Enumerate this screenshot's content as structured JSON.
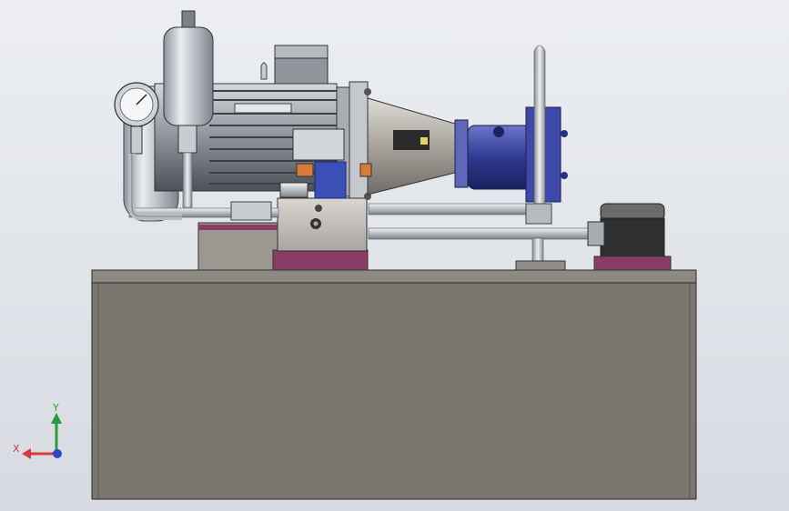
{
  "scene": {
    "background_top": "#e6e9ee",
    "background_bottom": "#d9dde3",
    "tank_color": "#7b7670",
    "motor_color": "#9aa0a7",
    "pump_color": "#2f3a8f",
    "valve_block_color": "#3b4fb8",
    "accent_magenta": "#8a3c63",
    "filter_color": "#3a3a3a"
  },
  "triad": {
    "x_label": "X",
    "y_label": "Y",
    "x_color": "#d43b3b",
    "y_color": "#2a9a3a",
    "z_color": "#3145c8"
  }
}
